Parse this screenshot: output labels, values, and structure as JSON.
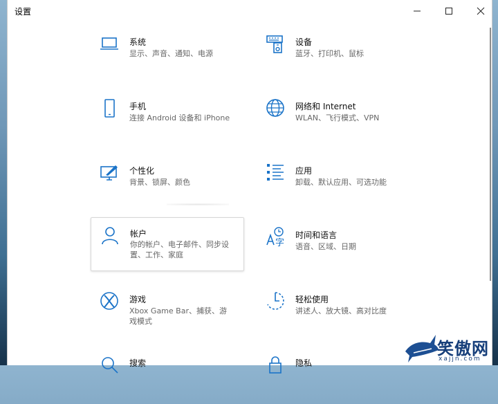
{
  "window": {
    "title": "设置"
  },
  "tiles": [
    {
      "name": "系统",
      "desc": "显示、声音、通知、电源",
      "icon": "laptop-icon"
    },
    {
      "name": "设备",
      "desc": "蓝牙、打印机、鼠标",
      "icon": "keyboard-device-icon"
    },
    {
      "name": "手机",
      "desc": "连接 Android 设备和 iPhone",
      "icon": "phone-icon"
    },
    {
      "name": "网络和 Internet",
      "desc": "WLAN、飞行模式、VPN",
      "icon": "globe-icon"
    },
    {
      "name": "个性化",
      "desc": "背景、锁屏、颜色",
      "icon": "paint-brush-icon"
    },
    {
      "name": "应用",
      "desc": "卸载、默认应用、可选功能",
      "icon": "apps-list-icon"
    },
    {
      "name": "帐户",
      "desc": "你的帐户、电子邮件、同步设置、工作、家庭",
      "icon": "person-icon"
    },
    {
      "name": "时间和语言",
      "desc": "语音、区域、日期",
      "icon": "time-language-icon"
    },
    {
      "name": "游戏",
      "desc": "Xbox Game Bar、捕获、游戏模式",
      "icon": "xbox-icon"
    },
    {
      "name": "轻松使用",
      "desc": "讲述人、放大镜、高对比度",
      "icon": "ease-of-access-icon"
    },
    {
      "name": "搜索",
      "desc": "",
      "icon": "search-icon"
    },
    {
      "name": "隐私",
      "desc": "",
      "icon": "lock-icon"
    }
  ],
  "watermark": {
    "text": "笑傲网",
    "url": "xajjn.com"
  },
  "colors": {
    "accent": "#1a73c8",
    "watermark": "#173f7a"
  }
}
